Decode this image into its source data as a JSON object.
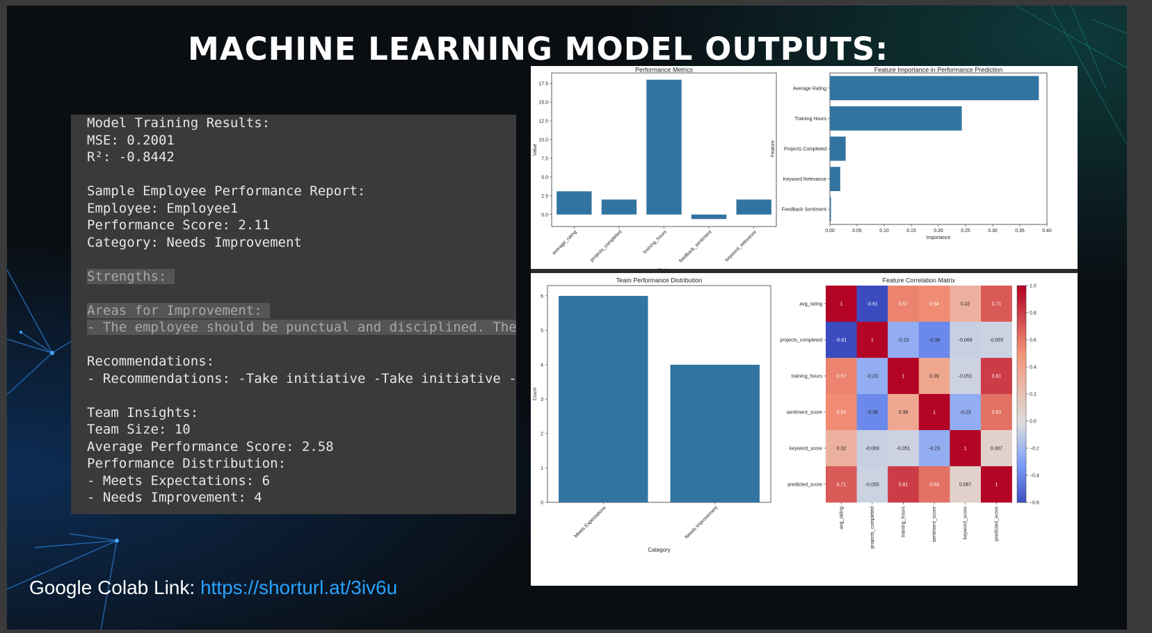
{
  "title": "MACHINE LEARNING MODEL OUTPUTS:",
  "console": {
    "lines": [
      {
        "text": "Model Training Results:",
        "hl": false
      },
      {
        "text": "MSE: 0.2001",
        "hl": false
      },
      {
        "text": "R²: -0.8442",
        "hl": false
      },
      {
        "text": "",
        "hl": false
      },
      {
        "text": "Sample Employee Performance Report:",
        "hl": false
      },
      {
        "text": "Employee: Employee1",
        "hl": false
      },
      {
        "text": "Performance Score: 2.11",
        "hl": false
      },
      {
        "text": "Category: Needs Improvement",
        "hl": false
      },
      {
        "text": "",
        "hl": false
      },
      {
        "text": "Strengths: ",
        "hl": true
      },
      {
        "text": "",
        "hl": false
      },
      {
        "text": "Areas for Improvement: ",
        "hl": true
      },
      {
        "text": "- The employee should be punctual and disciplined. The",
        "hl": true
      },
      {
        "text": "",
        "hl": false
      },
      {
        "text": "Recommendations:",
        "hl": false
      },
      {
        "text": "- Recommendations: -Take initiative -Take initiative -",
        "hl": false
      },
      {
        "text": "",
        "hl": false
      },
      {
        "text": "Team Insights:",
        "hl": false
      },
      {
        "text": "Team Size: 10",
        "hl": false
      },
      {
        "text": "Average Performance Score: 2.58",
        "hl": false
      },
      {
        "text": "Performance Distribution:",
        "hl": false
      },
      {
        "text": "- Meets Expectations: 6",
        "hl": false
      },
      {
        "text": "- Needs Improvement: 4",
        "hl": false
      }
    ]
  },
  "colab": {
    "label": "Google Colab Link: ",
    "link": "https://shorturl.at/3iv6u"
  },
  "chart_data": [
    {
      "type": "bar",
      "title": "Performance Metrics",
      "xlabel": "Metric",
      "ylabel": "Value",
      "categories": [
        "average_rating",
        "projects_completed",
        "training_hours",
        "feedback_sentiment",
        "keyword_relevance"
      ],
      "values": [
        3.1,
        2.0,
        18.0,
        -0.6,
        2.0
      ],
      "ylim": [
        -1.6,
        18.9
      ],
      "yticks": [
        "0.0",
        "2.5",
        "5.0",
        "7.5",
        "10.0",
        "12.5",
        "15.0",
        "17.5"
      ],
      "color": "#3274a1"
    },
    {
      "type": "bar",
      "orientation": "horizontal",
      "title": "Feature Importance in Performance Prediction",
      "xlabel": "Importance",
      "ylabel": "Feature",
      "categories": [
        "Average Rating",
        "Training Hours",
        "Projects Completed",
        "Keyword Relevance",
        "Feedback Sentiment"
      ],
      "values": [
        0.385,
        0.243,
        0.029,
        0.019,
        0.002
      ],
      "xlim": [
        0,
        0.4
      ],
      "xticks": [
        "0.00",
        "0.05",
        "0.10",
        "0.15",
        "0.20",
        "0.25",
        "0.30",
        "0.35",
        "0.40"
      ],
      "color": "#3274a1"
    },
    {
      "type": "bar",
      "title": "Team Performance Distribution",
      "xlabel": "Category",
      "ylabel": "Count",
      "categories": [
        "Meets Expectations",
        "Needs Improvement"
      ],
      "values": [
        6,
        4
      ],
      "ylim": [
        0,
        6.3
      ],
      "yticks": [
        "0",
        "1",
        "2",
        "3",
        "4",
        "5",
        "6"
      ],
      "color": "#3274a1"
    },
    {
      "type": "heatmap",
      "title": "Feature Correlation Matrix",
      "labels": [
        "avg_rating",
        "projects_completed",
        "training_hours",
        "sentiment_score",
        "keyword_score",
        "predicted_score"
      ],
      "matrix": [
        [
          1,
          -0.61,
          0.57,
          0.54,
          0.32,
          0.71
        ],
        [
          -0.61,
          1,
          -0.23,
          -0.38,
          -0.069,
          -0.055
        ],
        [
          0.57,
          -0.23,
          1,
          0.39,
          -0.051,
          0.81
        ],
        [
          0.54,
          -0.38,
          0.39,
          1,
          -0.23,
          0.63
        ],
        [
          0.32,
          -0.069,
          -0.051,
          -0.23,
          1,
          0.087
        ],
        [
          0.71,
          -0.055,
          0.81,
          0.63,
          0.087,
          1
        ]
      ],
      "cells": [
        [
          "1",
          "-0.61",
          "0.57",
          "0.54",
          "0.32",
          "0.71"
        ],
        [
          "-0.61",
          "1",
          "-0.23",
          "-0.38",
          "-0.069",
          "-0.055"
        ],
        [
          "0.57",
          "-0.23",
          "1",
          "0.39",
          "-0.051",
          "0.81"
        ],
        [
          "0.54",
          "-0.38",
          "0.39",
          "1",
          "-0.23",
          "0.63"
        ],
        [
          "0.32",
          "-0.069",
          "-0.051",
          "-0.23",
          "1",
          "0.087"
        ],
        [
          "0.71",
          "-0.055",
          "0.81",
          "0.63",
          "0.087",
          "1"
        ]
      ],
      "colorbar_ticks": [
        "1.0",
        "0.8",
        "0.6",
        "0.4",
        "0.2",
        "0.0",
        "−0.2",
        "−0.4",
        "−0.6"
      ],
      "vmin": -0.6,
      "vmax": 1.0,
      "colormap": "coolwarm"
    }
  ]
}
